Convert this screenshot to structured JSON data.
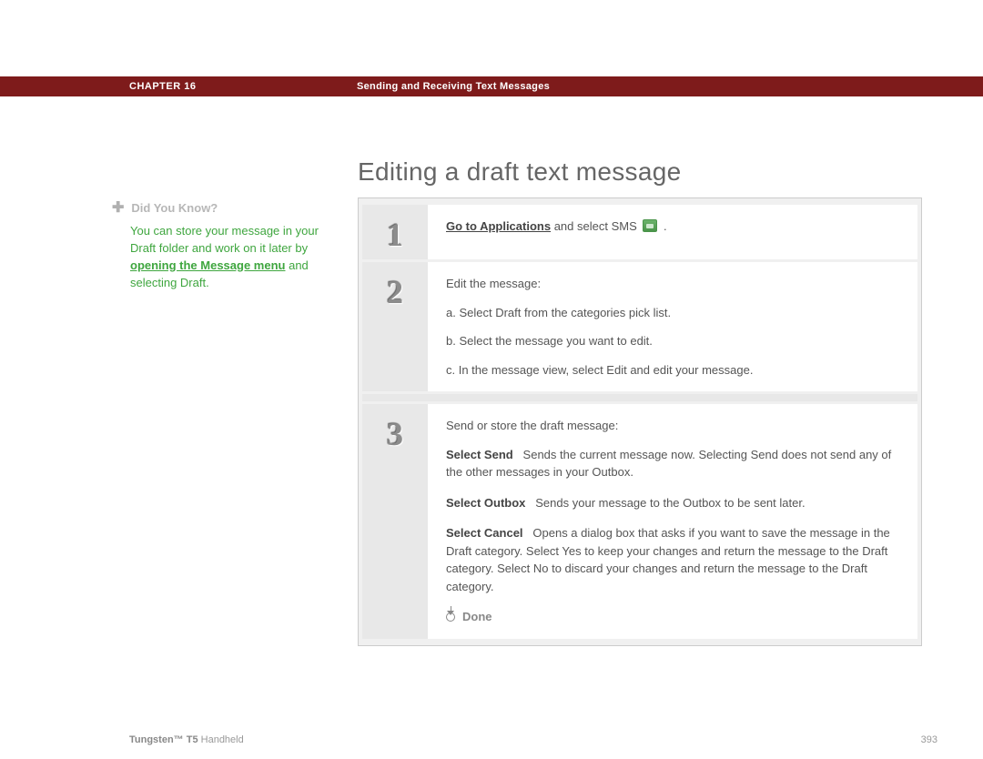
{
  "header": {
    "chapter": "CHAPTER 16",
    "section": "Sending and Receiving Text Messages"
  },
  "title": "Editing a draft text message",
  "sidebar": {
    "dyk_label": "Did You Know?",
    "body_prefix": "You can store your message in your Draft folder and work on it later by ",
    "body_link": "opening the Message menu",
    "body_suffix": " and selecting Draft."
  },
  "steps": {
    "s1": {
      "num": "1",
      "link": "Go to Applications",
      "suffix": " and select SMS "
    },
    "s2": {
      "num": "2",
      "intro": "Edit the message:",
      "a": "a.  Select Draft from the categories pick list.",
      "b": "b.  Select the message you want to edit.",
      "c": "c.  In the message view, select Edit and edit your message."
    },
    "s3": {
      "num": "3",
      "intro": "Send or store the draft message:",
      "send_label": "Select Send",
      "send_text": "Sends the current message now. Selecting Send does not send any of the other messages in your Outbox.",
      "outbox_label": "Select Outbox",
      "outbox_text": "Sends your message to the Outbox to be sent later.",
      "cancel_label": "Select Cancel",
      "cancel_text": "Opens a dialog box that asks if you want to save the message in the Draft category. Select Yes to keep your changes and return the message to the Draft category. Select No to discard your changes and return the message to the Draft category.",
      "done": "Done"
    }
  },
  "footer": {
    "product_bold": "Tungsten™ T5",
    "product_rest": " Handheld",
    "page": "393"
  }
}
